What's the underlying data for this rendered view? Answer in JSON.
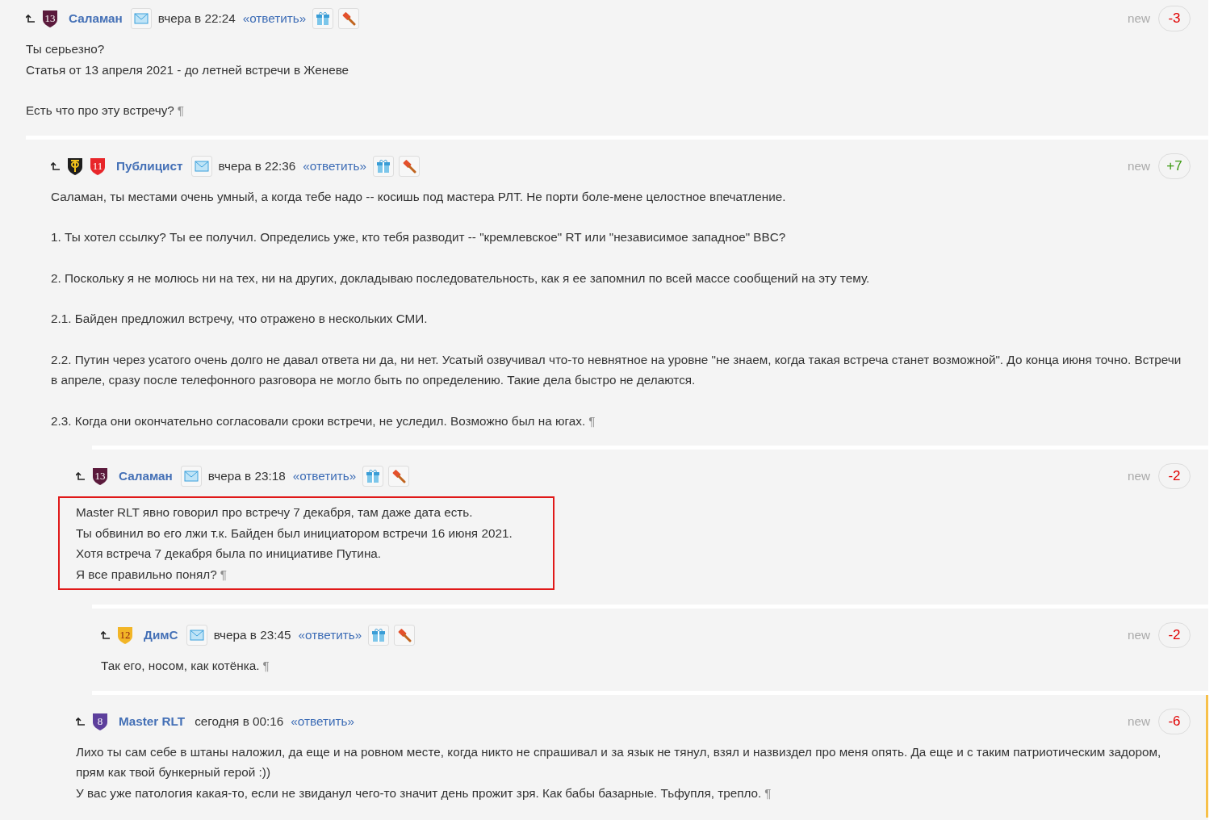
{
  "comments": [
    {
      "author": "Саламан",
      "badges": [
        {
          "kind": "number",
          "label": "13",
          "color": "#5b1a3c"
        }
      ],
      "tools": true,
      "date": "вчера в 22:24",
      "reply": "«ответить»",
      "new_label": "new",
      "score": "-3",
      "color": "#e00000",
      "highlighted": false,
      "flagged": false,
      "end_mark": "¶",
      "body": [
        [
          "Ты серьезно?",
          "Статья от 13 апреля 2021 - до летней встречи в Женеве"
        ],
        [
          "Есть что про эту встречу?"
        ]
      ],
      "children": [
        {
          "author": "Публицист",
          "badges": [
            {
              "kind": "emblem",
              "color": "#1e1e1e"
            },
            {
              "kind": "number",
              "label": "11",
              "color": "#e8262a"
            }
          ],
          "tools": true,
          "date": "вчера в 22:36",
          "reply": "«ответить»",
          "new_label": "new",
          "score": "+7",
          "color": "#3c9a10",
          "highlighted": false,
          "flagged": false,
          "end_mark": "¶",
          "body": [
            [
              "Саламан, ты местами очень умный, а когда тебе надо -- косишь под мастера РЛТ. Не порти боле-мене целостное впечатление."
            ],
            [
              "1. Ты хотел ссылку? Ты ее получил. Определись уже, кто тебя разводит -- \"кремлевское\" RT или \"независимое западное\" BBC?"
            ],
            [
              "2. Поскольку я не молюсь ни на тех, ни на других, докладываю последовательность, как я ее запомнил по всей массе сообщений на эту тему."
            ],
            [
              "2.1. Байден предложил встречу, что отражено в нескольких СМИ."
            ],
            [
              "2.2. Путин через усатого очень долго не давал ответа ни да, ни нет. Усатый озвучивал что-то невнятное на уровне \"не знаем, когда такая встреча станет возможной\". До конца июня точно. Встречи в апреле, сразу после телефонного разговора не могло быть по определению. Такие дела быстро не делаются."
            ],
            [
              "2.3. Когда они окончательно согласовали сроки встречи, не уследил. Возможно был на югах."
            ]
          ],
          "children": [
            {
              "author": "Саламан",
              "badges": [
                {
                  "kind": "number",
                  "label": "13",
                  "color": "#5b1a3c"
                }
              ],
              "tools": true,
              "date": "вчера в 23:18",
              "reply": "«ответить»",
              "new_label": "new",
              "score": "-2",
              "color": "#e00000",
              "highlighted": true,
              "flagged": false,
              "end_mark": "¶",
              "body": [
                [
                  "Master RLT явно говорил про встречу 7 декабря, там даже дата есть.",
                  "Ты обвинил во его лжи т.к. Байден был инициатором встречи 16 июня 2021.",
                  "Хотя встреча 7 декабря была по инициативе Путина.",
                  "Я все правильно понял?"
                ]
              ],
              "children": [
                {
                  "author": "ДимС",
                  "badges": [
                    {
                      "kind": "number",
                      "label": "12",
                      "color": "#f2b526"
                    }
                  ],
                  "tools": true,
                  "date": "вчера в 23:45",
                  "reply": "«ответить»",
                  "new_label": "new",
                  "score": "-2",
                  "color": "#e00000",
                  "highlighted": false,
                  "flagged": false,
                  "end_mark": "¶",
                  "body": [
                    [
                      "Так его, носом, как котёнка."
                    ]
                  ]
                }
              ]
            },
            {
              "author": "Master RLT",
              "badges": [
                {
                  "kind": "number",
                  "label": "8",
                  "color": "#5d3f9c"
                }
              ],
              "tools": false,
              "date": "сегодня в 00:16",
              "reply": "«ответить»",
              "new_label": "new",
              "score": "-6",
              "color": "#e00000",
              "highlighted": false,
              "flagged": true,
              "end_mark": "¶",
              "body": [
                [
                  "Лихо ты сам себе в штаны наложил, да еще и на ровном месте, когда никто не спрашивал и за язык не тянул, взял и назвиздел про меня опять. Да еще и с таким патриотическим задором, прям как твой бункерный герой :))",
                  "У вас уже патология какая-то, если не звиданул чего-то значит день прожит зря. Как бабы базарные. Тьфупля, трепло."
                ]
              ]
            }
          ]
        }
      ]
    }
  ]
}
